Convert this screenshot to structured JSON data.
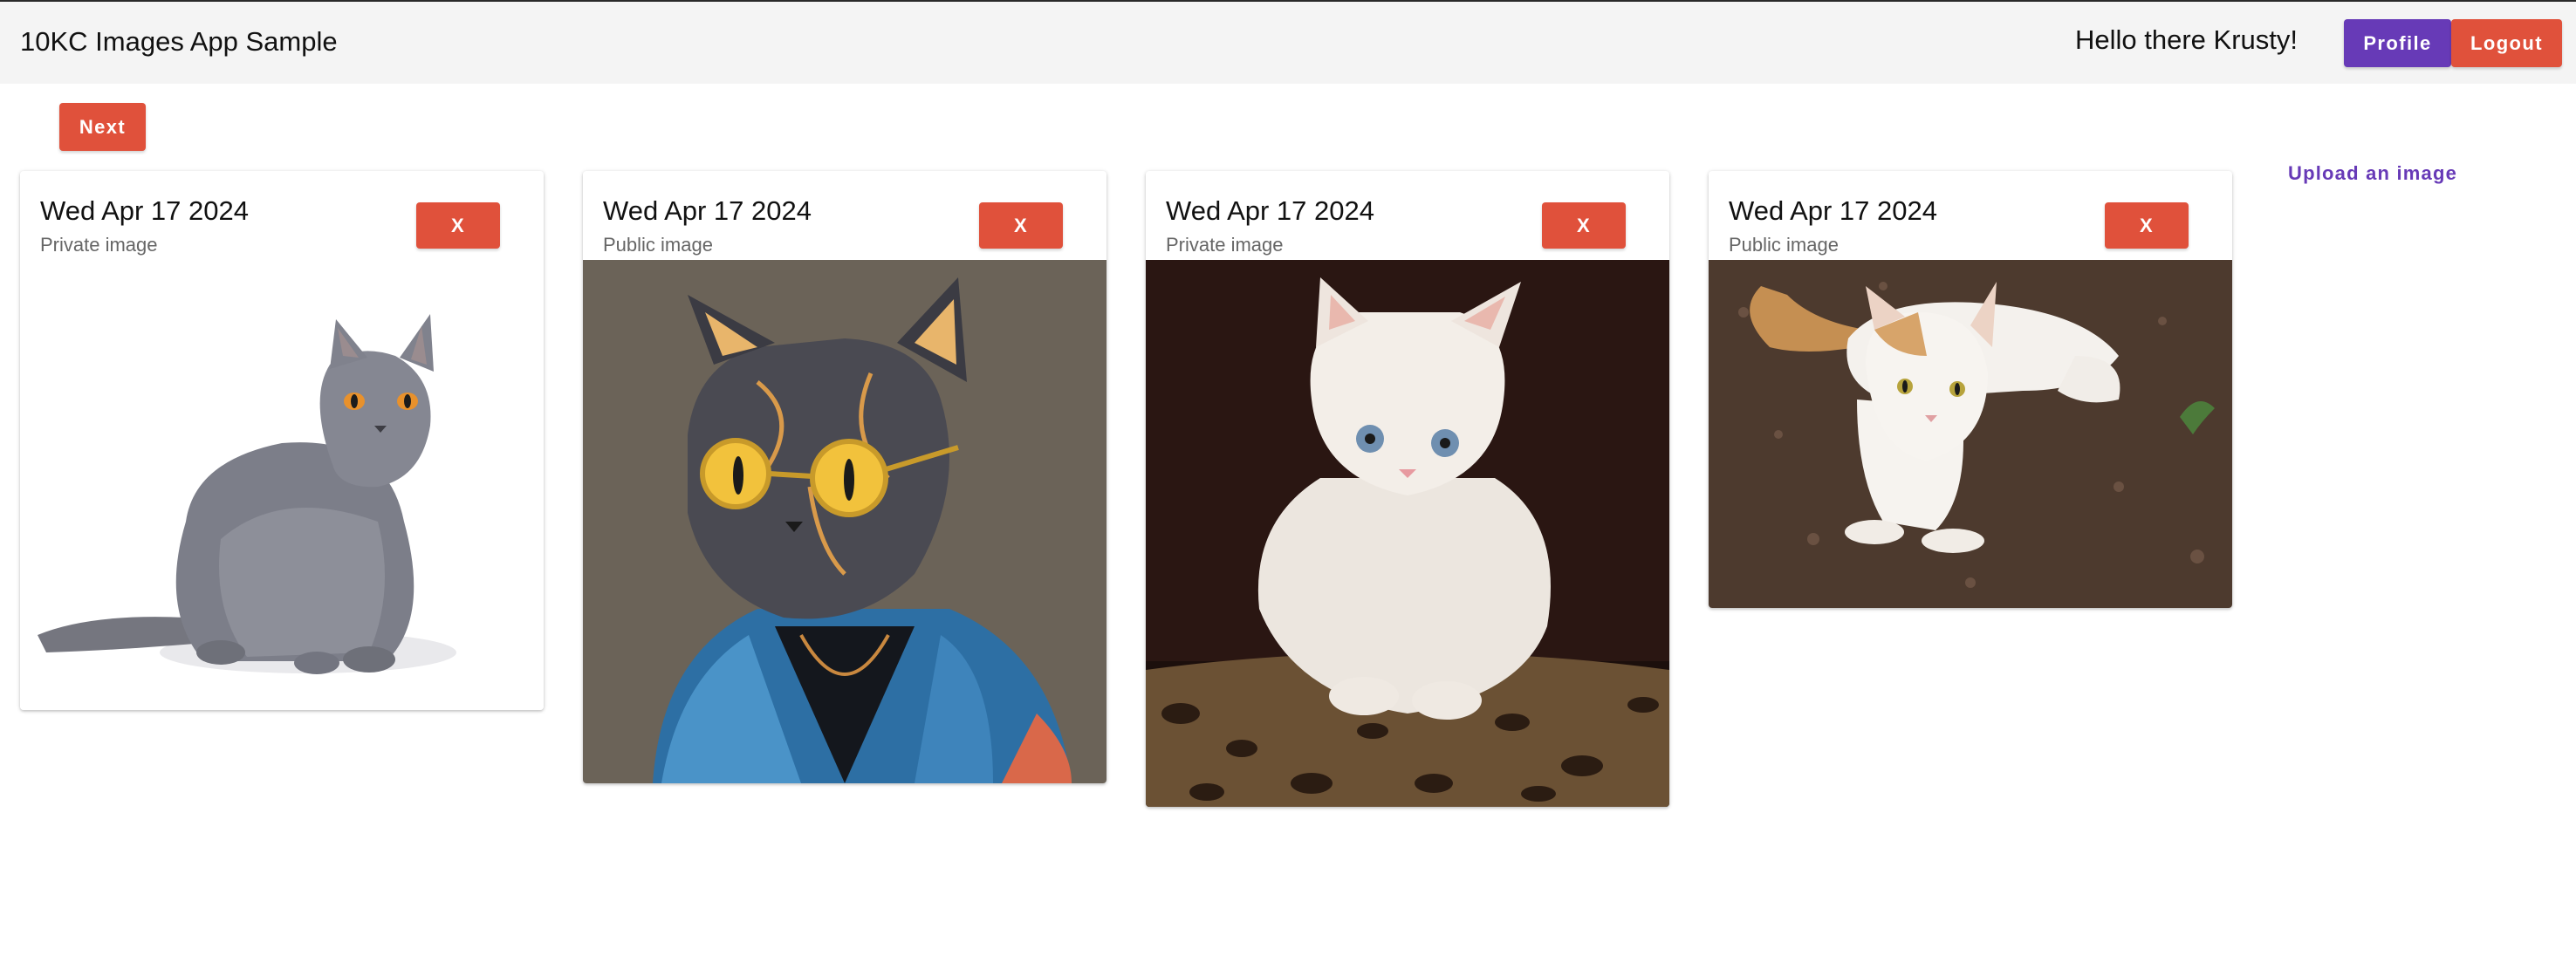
{
  "header": {
    "app_title": "10KC Images App Sample",
    "greeting": "Hello there Krusty!",
    "profile_label": "Profile",
    "logout_label": "Logout"
  },
  "toolbar": {
    "next_label": "Next",
    "upload_label": "Upload an image"
  },
  "colors": {
    "primary_purple": "#673ab7",
    "danger_red": "#e0513b",
    "header_bg": "#f4f4f4"
  },
  "cards": [
    {
      "date": "Wed Apr 17 2024",
      "privacy": "Private image",
      "delete_label": "X",
      "image": "gray-cat-photo"
    },
    {
      "date": "Wed Apr 17 2024",
      "privacy": "Public image",
      "delete_label": "X",
      "image": "cat-with-glasses-illustration"
    },
    {
      "date": "Wed Apr 17 2024",
      "privacy": "Private image",
      "delete_label": "X",
      "image": "white-kitten-photo"
    },
    {
      "date": "Wed Apr 17 2024",
      "privacy": "Public image",
      "delete_label": "X",
      "image": "white-orange-cat-on-soil-photo"
    }
  ]
}
